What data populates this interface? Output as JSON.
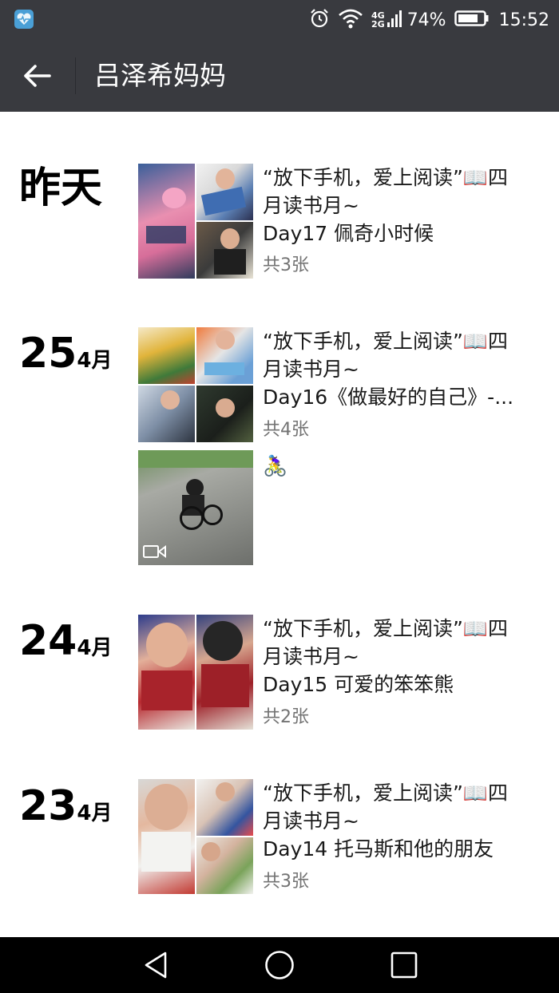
{
  "status_bar": {
    "network_type_top": "4G",
    "network_type_bottom": "2G",
    "battery_percent": "74%",
    "time": "15:52"
  },
  "header": {
    "title": "吕泽希妈妈"
  },
  "feed": {
    "entries": [
      {
        "date_label": "昨天",
        "text_lines": [
          "“放下手机，爱上阅读”📖四",
          "月读书月~",
          "Day17 佩奇小时候"
        ],
        "photo_count": "共3张"
      },
      {
        "date_day": "25",
        "date_month": "4月",
        "text_lines": [
          "“放下手机，爱上阅读”📖四",
          "月读书月~",
          "Day16《做最好的自己》-..."
        ],
        "photo_count": "共4张",
        "video_caption": "🚴‍♀️"
      },
      {
        "date_day": "24",
        "date_month": "4月",
        "text_lines": [
          "“放下手机，爱上阅读”📖四",
          "月读书月~",
          "Day15 可爱的笨笨熊"
        ],
        "photo_count": "共2张"
      },
      {
        "date_day": "23",
        "date_month": "4月",
        "text_lines": [
          "“放下手机，爱上阅读”📖四",
          "月读书月~",
          "Day14 托马斯和他的朋友"
        ],
        "photo_count": "共3张"
      }
    ]
  },
  "colors": {
    "bar_background": "#393a3f",
    "nav_background": "#000000",
    "secondary_text": "#737373"
  },
  "icons": {
    "status": [
      "health-app-icon",
      "alarm-icon",
      "wifi-icon",
      "signal-icon",
      "battery-icon"
    ],
    "navigation": [
      "back-arrow-icon",
      "nav-back-icon",
      "nav-home-icon",
      "nav-recent-icon"
    ],
    "media": [
      "video-icon"
    ]
  }
}
